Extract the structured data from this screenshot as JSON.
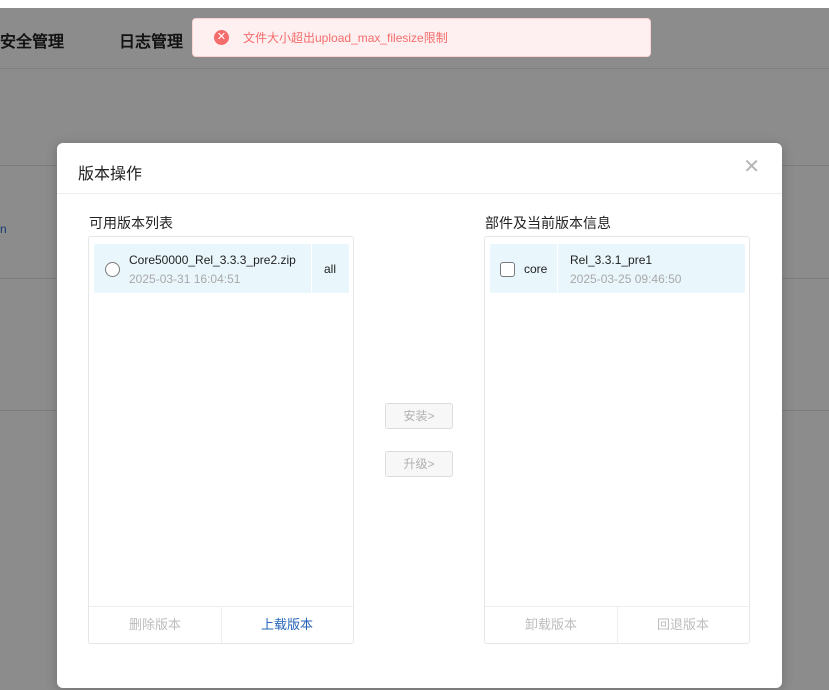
{
  "background": {
    "nav": [
      {
        "label": "安全管理"
      },
      {
        "label": "日志管理"
      }
    ],
    "fragment_text": "n"
  },
  "toast": {
    "icon": "error-circle-icon",
    "message": "文件大小超出upload_max_filesize限制",
    "color": "#f56c6c"
  },
  "dialog": {
    "title": "版本操作",
    "close_icon": "close-icon",
    "left_panel": {
      "title": "可用版本列表",
      "items": [
        {
          "name": "Core50000_Rel_3.3.3_pre2.zip",
          "time": "2025-03-31 16:04:51",
          "tag": "all"
        }
      ],
      "footer": {
        "delete_label": "删除版本",
        "upload_label": "上载版本"
      }
    },
    "middle": {
      "install_label": "安装>",
      "upgrade_label": "升级>"
    },
    "right_panel": {
      "title": "部件及当前版本信息",
      "items": [
        {
          "component": "core",
          "version": "Rel_3.3.1_pre1",
          "time": "2025-03-25 09:46:50"
        }
      ],
      "footer": {
        "uninstall_label": "卸载版本",
        "rollback_label": "回退版本"
      }
    }
  }
}
